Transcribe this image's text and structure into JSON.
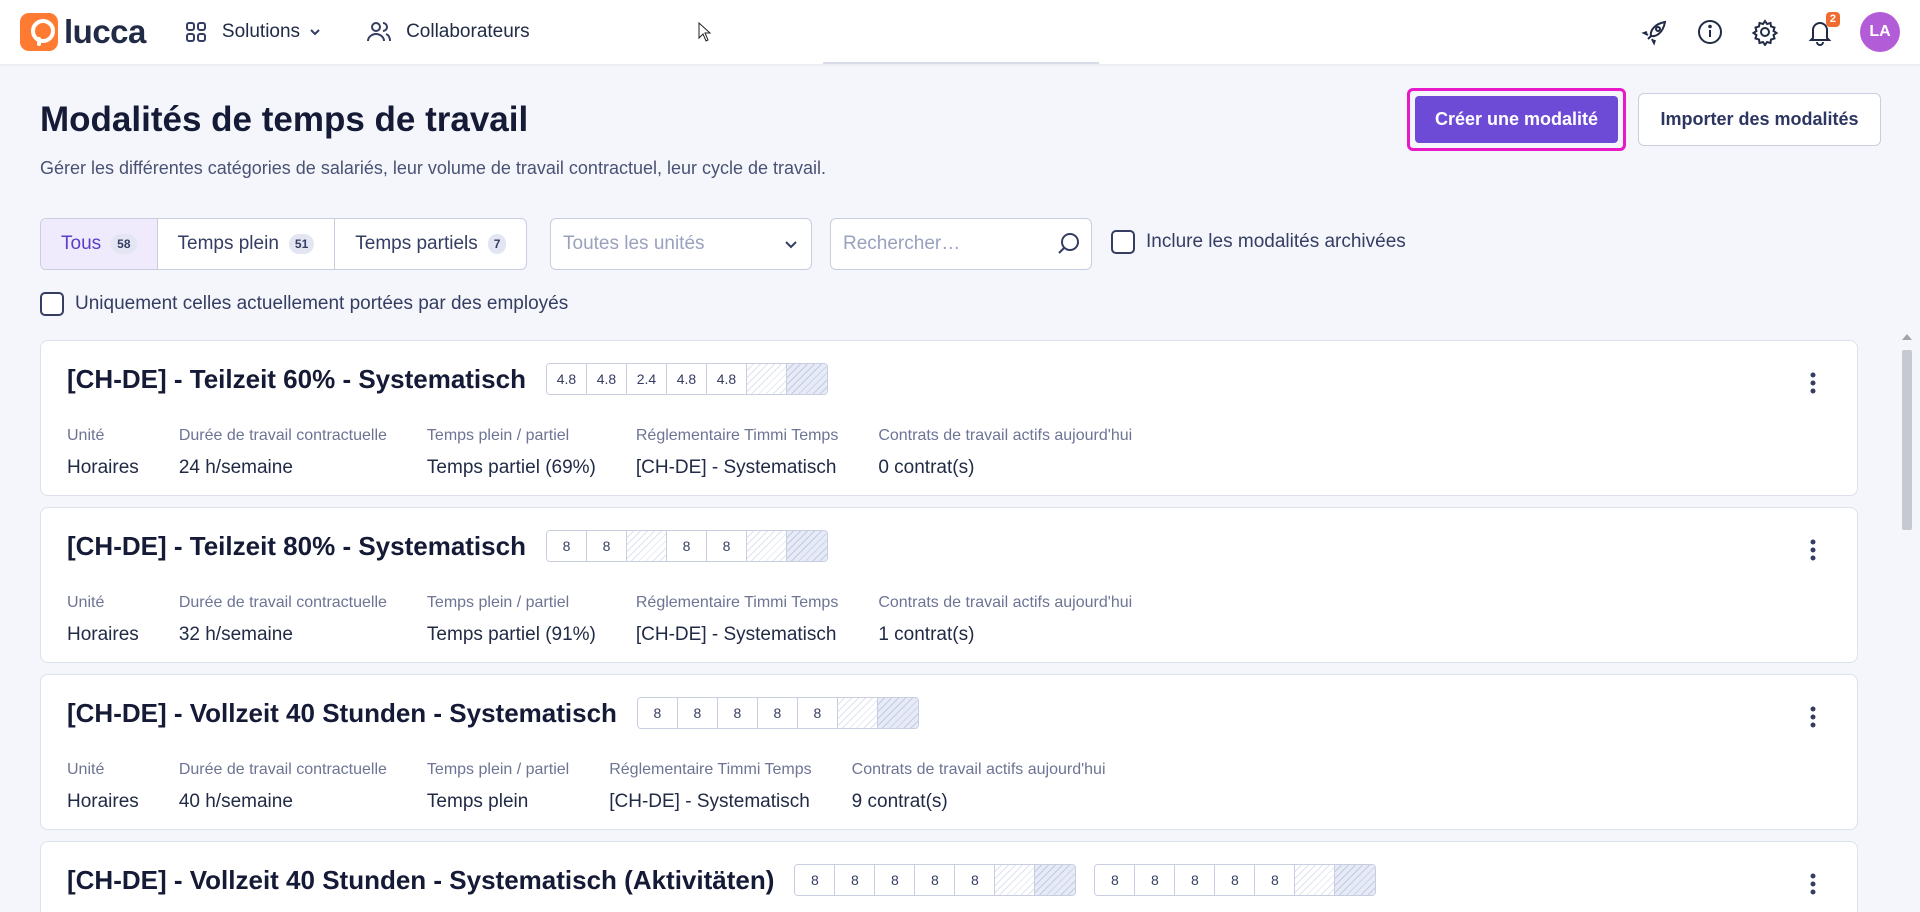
{
  "topnav": {
    "logo_text": "lucca",
    "solutions_label": "Solutions",
    "collaborateurs_label": "Collaborateurs",
    "notifications_count": "2",
    "avatar_initials": "LA"
  },
  "header": {
    "title": "Modalités de temps de travail",
    "subtitle": "Gérer les différentes catégories de salariés, leur volume de travail contractuel, leur cycle de travail.",
    "create_button": "Créer une modalité",
    "import_button": "Importer des modalités"
  },
  "filters": {
    "segments": [
      {
        "label": "Tous",
        "count": "58"
      },
      {
        "label": "Temps plein",
        "count": "51"
      },
      {
        "label": "Temps partiels",
        "count": "7"
      }
    ],
    "units_placeholder": "Toutes les unités",
    "search_placeholder": "Rechercher…",
    "include_archived_label": "Inclure les modalités archivées",
    "only_current_label": "Uniquement celles actuellement portées par des employés"
  },
  "meta_labels": {
    "unit": "Unité",
    "duration": "Durée de travail contractuelle",
    "fulltime": "Temps plein / partiel",
    "regulation": "Réglementaire Timmi Temps",
    "contracts": "Contrats de travail actifs aujourd'hui"
  },
  "cards": [
    {
      "title": "[CH-DE] - Teilzeit 60% - Systematisch",
      "patterns": [
        [
          "4.8",
          "4.8",
          "2.4",
          "4.8",
          "4.8",
          "",
          ""
        ]
      ],
      "unit": "Horaires",
      "duration": "24 h/semaine",
      "fulltime": "Temps partiel (69%)",
      "regulation": "[CH-DE] - Systematisch",
      "contracts": "0 contrat(s)"
    },
    {
      "title": "[CH-DE] - Teilzeit 80% - Systematisch",
      "patterns": [
        [
          "8",
          "8",
          "",
          "8",
          "8",
          "",
          ""
        ]
      ],
      "unit": "Horaires",
      "duration": "32 h/semaine",
      "fulltime": "Temps partiel (91%)",
      "regulation": "[CH-DE] - Systematisch",
      "contracts": "1 contrat(s)"
    },
    {
      "title": "[CH-DE] - Vollzeit 40 Stunden - Systematisch",
      "patterns": [
        [
          "8",
          "8",
          "8",
          "8",
          "8",
          "",
          ""
        ]
      ],
      "unit": "Horaires",
      "duration": "40 h/semaine",
      "fulltime": "Temps plein",
      "regulation": "[CH-DE] - Systematisch",
      "contracts": "9 contrat(s)"
    },
    {
      "title": "[CH-DE] - Vollzeit 40 Stunden - Systematisch (Aktivitäten)",
      "patterns": [
        [
          "8",
          "8",
          "8",
          "8",
          "8",
          "",
          ""
        ],
        [
          "8",
          "8",
          "8",
          "8",
          "8",
          "",
          ""
        ]
      ],
      "unit": "",
      "duration": "",
      "fulltime": "",
      "regulation": "",
      "contracts": ""
    }
  ],
  "colors": {
    "primary": "#6d4bd6",
    "highlight": "#e719c9",
    "logo": "#ff7b31",
    "avatar": "#b35cd8"
  }
}
